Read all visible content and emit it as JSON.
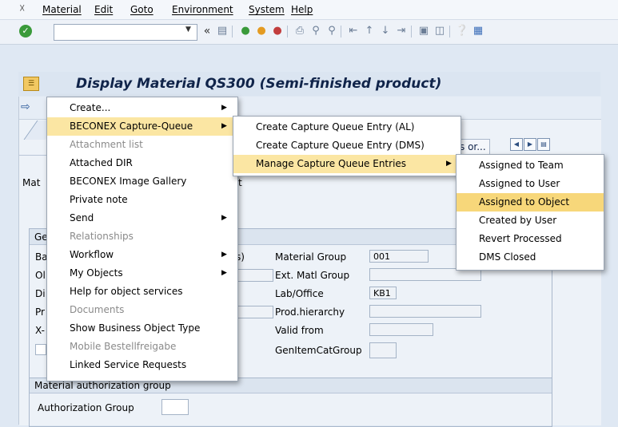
{
  "menubar": {
    "items": [
      "Material",
      "Edit",
      "Goto",
      "Environment",
      "System",
      "Help"
    ]
  },
  "toolbar": {
    "command_field_value": "",
    "back_glyph": "«"
  },
  "titlebar": {
    "title": "Display Material QS300 (Semi-finished product)"
  },
  "tabs": {
    "partial_tab_label": "s or..."
  },
  "form": {
    "material_label_partial": "Mat",
    "description_tail": "t",
    "general_section_partial": "Ge",
    "left_labels_partial": [
      "Ba",
      "Ol",
      "Di",
      "Pr",
      "X-"
    ],
    "uom_tail": "s)",
    "material_group_label": "Material Group",
    "material_group_value": "001",
    "ext_matl_group_label": "Ext. Matl Group",
    "lab_office_label": "Lab/Office",
    "lab_office_value": "KB1",
    "prod_hierarchy_label": "Prod.hierarchy",
    "valid_from_label": "Valid from",
    "gen_item_cat_group_label": "GenItemCatGroup",
    "auth_section_title": "Material authorization group",
    "auth_group_label": "Authorization Group"
  },
  "context_menu": {
    "items": [
      {
        "label": "Create...",
        "enabled": true,
        "submenu": true
      },
      {
        "label": "BECONEX Capture-Queue",
        "enabled": true,
        "submenu": true,
        "highlighted": true
      },
      {
        "label": "Attachment list",
        "enabled": false,
        "submenu": false
      },
      {
        "label": "Attached DIR",
        "enabled": true,
        "submenu": false
      },
      {
        "label": "BECONEX Image Gallery",
        "enabled": true,
        "submenu": false
      },
      {
        "label": "Private note",
        "enabled": true,
        "submenu": false
      },
      {
        "label": "Send",
        "enabled": true,
        "submenu": true
      },
      {
        "label": "Relationships",
        "enabled": false,
        "submenu": false
      },
      {
        "label": "Workflow",
        "enabled": true,
        "submenu": true
      },
      {
        "label": "My Objects",
        "enabled": true,
        "submenu": true
      },
      {
        "label": "Help for object services",
        "enabled": true,
        "submenu": false
      },
      {
        "label": "Documents",
        "enabled": false,
        "submenu": false
      },
      {
        "label": "Show Business Object Type",
        "enabled": true,
        "submenu": false
      },
      {
        "label": "Mobile Bestellfreigabe",
        "enabled": false,
        "submenu": false
      },
      {
        "label": "Linked Service Requests",
        "enabled": true,
        "submenu": false
      }
    ]
  },
  "capture_queue_menu": {
    "items": [
      {
        "label": "Create Capture Queue Entry (AL)",
        "submenu": false
      },
      {
        "label": "Create Capture Queue Entry (DMS)",
        "submenu": false
      },
      {
        "label": "Manage Capture Queue Entries",
        "submenu": true,
        "highlighted": true
      }
    ]
  },
  "manage_menu": {
    "items": [
      {
        "label": "Assigned to Team",
        "highlighted": false
      },
      {
        "label": "Assigned to User",
        "highlighted": false
      },
      {
        "label": "Assigned to Object",
        "highlighted": true
      },
      {
        "label": "Created by User",
        "highlighted": false
      },
      {
        "label": "Revert Processed",
        "highlighted": false
      },
      {
        "label": "DMS Closed",
        "highlighted": false
      }
    ]
  },
  "colors": {
    "highlight": "#f7d77a",
    "title_text": "#10244a"
  }
}
